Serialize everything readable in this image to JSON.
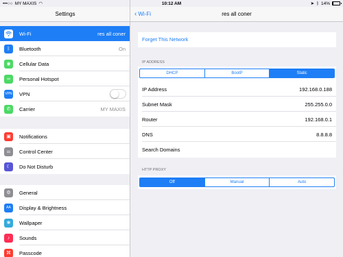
{
  "status_bar": {
    "carrier": "MY MAXIS",
    "time": "10:12 AM",
    "battery": "14%",
    "battery_level": 0.14
  },
  "sidebar": {
    "title": "Settings",
    "groups": [
      [
        {
          "label": "Wi-Fi",
          "value": "res all coner",
          "icon": "wifi-icon",
          "color": "#1e7ef5",
          "selected": true
        },
        {
          "label": "Bluetooth",
          "value": "On",
          "icon": "bluetooth-icon",
          "color": "#1e7ef5"
        },
        {
          "label": "Cellular Data",
          "value": "",
          "icon": "cellular-icon",
          "color": "#4cd964"
        },
        {
          "label": "Personal Hotspot",
          "value": "",
          "icon": "hotspot-icon",
          "color": "#4cd964"
        },
        {
          "label": "VPN",
          "value": "",
          "icon": "vpn-icon",
          "color": "#1e7ef5",
          "toggle": true
        },
        {
          "label": "Carrier",
          "value": "MY MAXIS",
          "icon": "phone-icon",
          "color": "#4cd964"
        }
      ],
      [
        {
          "label": "Notifications",
          "value": "",
          "icon": "notifications-icon",
          "color": "#ff3b30"
        },
        {
          "label": "Control Center",
          "value": "",
          "icon": "control-center-icon",
          "color": "#8e8e93"
        },
        {
          "label": "Do Not Disturb",
          "value": "",
          "icon": "moon-icon",
          "color": "#5856d6"
        }
      ],
      [
        {
          "label": "General",
          "value": "",
          "icon": "gear-icon",
          "color": "#8e8e93"
        },
        {
          "label": "Display & Brightness",
          "value": "",
          "icon": "display-icon",
          "color": "#1e7ef5"
        },
        {
          "label": "Wallpaper",
          "value": "",
          "icon": "wallpaper-icon",
          "color": "#34aadc"
        },
        {
          "label": "Sounds",
          "value": "",
          "icon": "sounds-icon",
          "color": "#ff2d55"
        },
        {
          "label": "Passcode",
          "value": "",
          "icon": "passcode-icon",
          "color": "#ff3b30"
        }
      ]
    ],
    "vpn_toggle_on": false
  },
  "detail": {
    "back_label": "Wi-Fi",
    "title": "res all coner",
    "forget_label": "Forget This Network",
    "ip_section_label": "IP ADDRESS",
    "ip_modes": [
      "DHCP",
      "BootP",
      "Static"
    ],
    "ip_mode_selected": "Static",
    "fields": [
      {
        "label": "IP Address",
        "value": "192.168.0.188"
      },
      {
        "label": "Subnet Mask",
        "value": "255.255.0.0"
      },
      {
        "label": "Router",
        "value": "192.168.0.1"
      },
      {
        "label": "DNS",
        "value": "8.8.8.8"
      },
      {
        "label": "Search Domains",
        "value": ""
      }
    ],
    "proxy_section_label": "HTTP PROXY",
    "proxy_modes": [
      "Off",
      "Manual",
      "Auto"
    ],
    "proxy_mode_selected": "Off"
  },
  "accent_color": "#1e7ef5"
}
